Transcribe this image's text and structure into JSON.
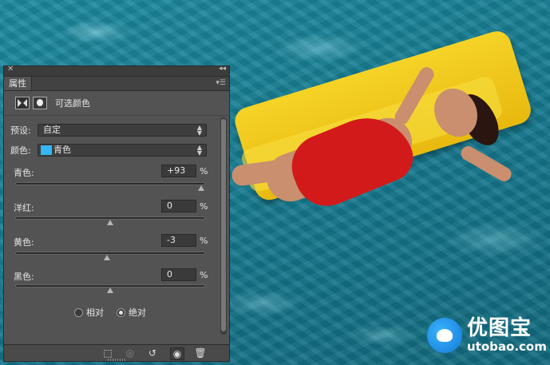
{
  "panel": {
    "tab_label": "属性",
    "header_title": "可选颜色",
    "preset": {
      "label": "预设:",
      "value": "自定"
    },
    "color": {
      "label": "颜色:",
      "value": "青色",
      "swatch": "#33b8f5"
    },
    "sliders": [
      {
        "label": "青色:",
        "value": "+93",
        "unit": "%",
        "position": 0.98
      },
      {
        "label": "洋红:",
        "value": "0",
        "unit": "%",
        "position": 0.5
      },
      {
        "label": "黄色:",
        "value": "-3",
        "unit": "%",
        "position": 0.485
      },
      {
        "label": "黑色:",
        "value": "0",
        "unit": "%",
        "position": 0.5
      }
    ],
    "method": {
      "relative_label": "相对",
      "absolute_label": "绝对",
      "selected": "absolute"
    },
    "bottom_icons": [
      "clip-to-layer-icon",
      "view-previous-state-icon",
      "reset-icon",
      "visibility-eye-icon",
      "trash-icon"
    ]
  },
  "watermark": {
    "name": "优图宝",
    "url": "utobao.com"
  }
}
